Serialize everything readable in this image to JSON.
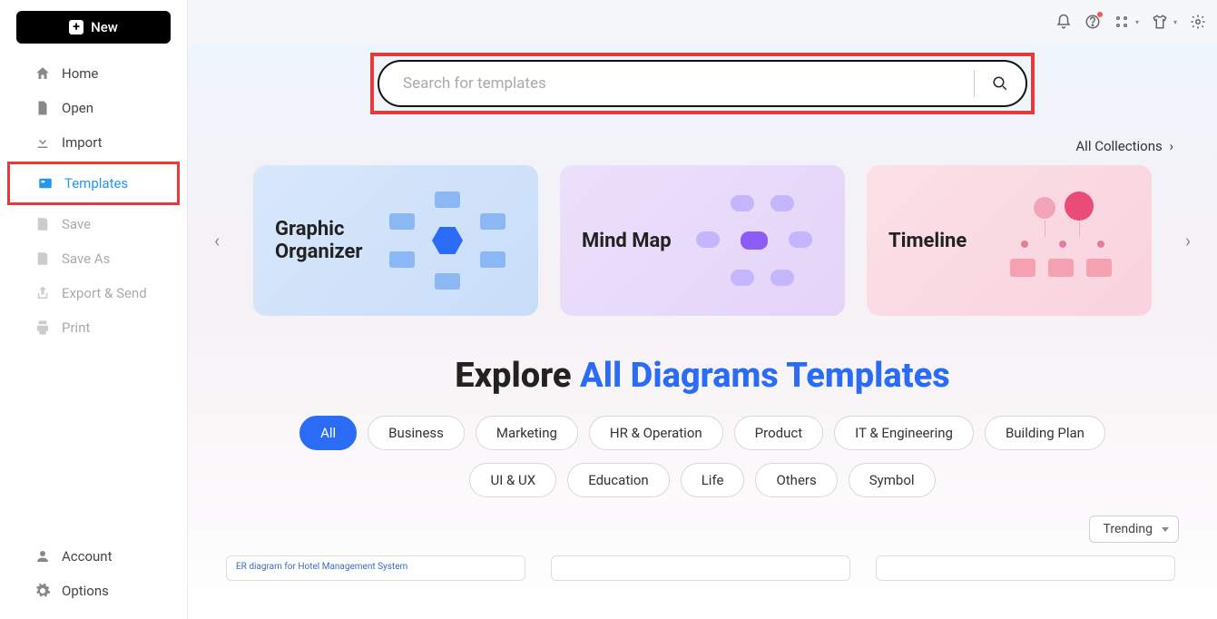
{
  "newButton": "New",
  "sidebar": {
    "home": "Home",
    "open": "Open",
    "import": "Import",
    "templates": "Templates",
    "save": "Save",
    "saveAs": "Save As",
    "exportSend": "Export & Send",
    "print": "Print",
    "account": "Account",
    "options": "Options"
  },
  "search": {
    "placeholder": "Search for templates"
  },
  "collectionsLink": "All Collections",
  "cards": {
    "graphicOrganizer": "Graphic Organizer",
    "mindMap": "Mind Map",
    "timeline": "Timeline"
  },
  "heading": {
    "prefix": "Explore ",
    "accent": "All Diagrams Templates"
  },
  "chips": [
    "All",
    "Business",
    "Marketing",
    "HR & Operation",
    "Product",
    "IT & Engineering",
    "Building Plan",
    "UI & UX",
    "Education",
    "Life",
    "Others",
    "Symbol"
  ],
  "sort": "Trending",
  "thumbs": {
    "t1": "ER diagram for Hotel Management System",
    "t2": "",
    "t3": ""
  }
}
